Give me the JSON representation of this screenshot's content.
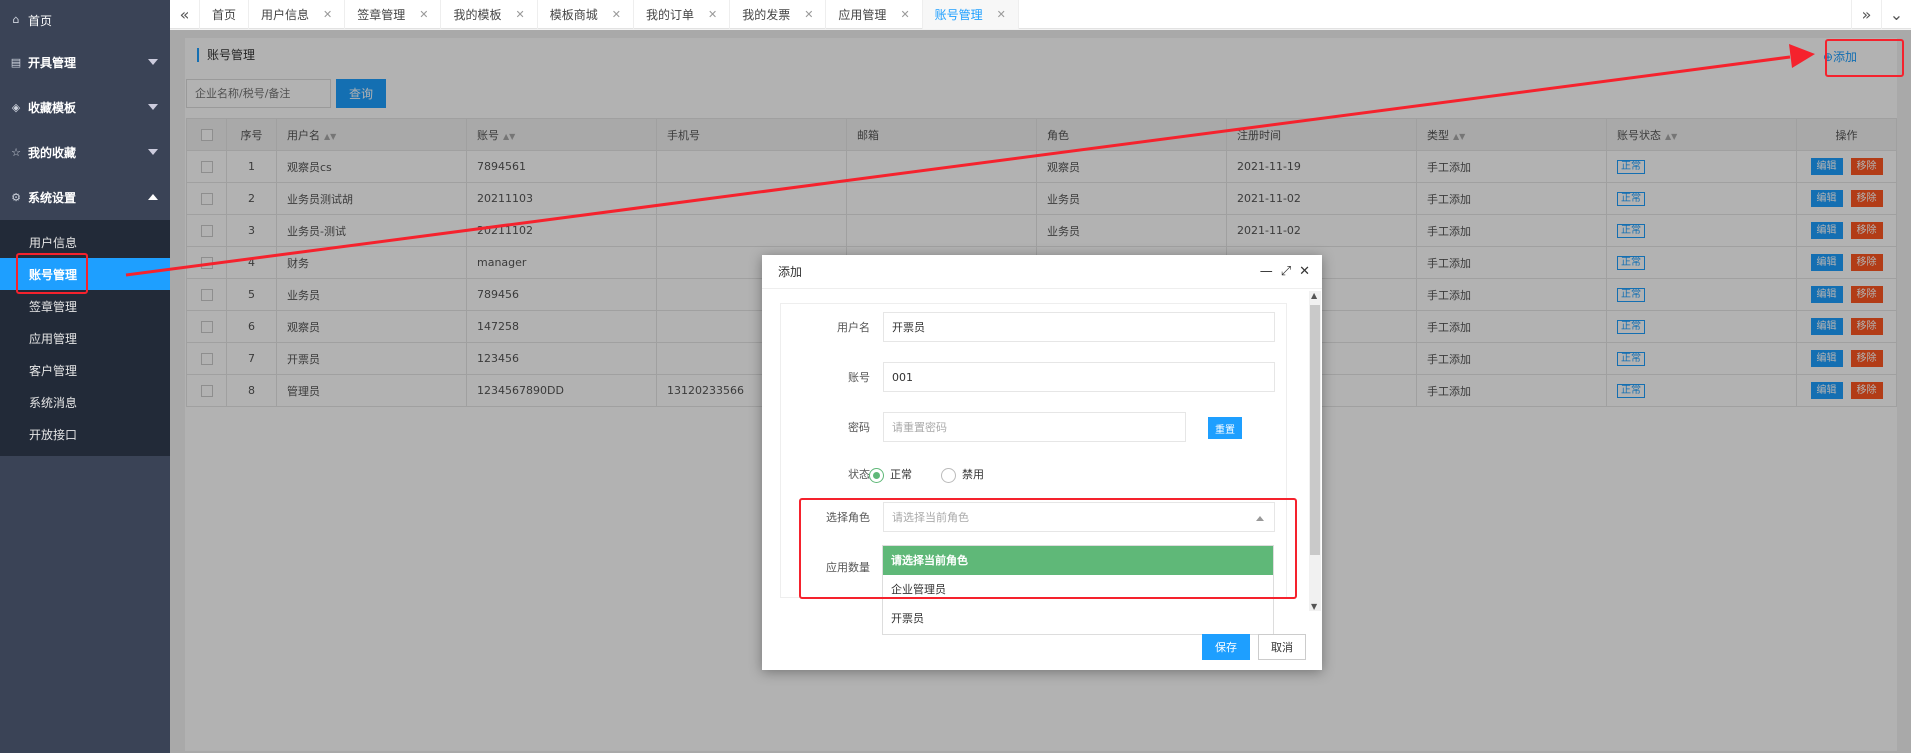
{
  "sidebar": {
    "home": "首页",
    "groups": [
      {
        "label": "开具管理"
      },
      {
        "label": "收藏模板"
      },
      {
        "label": "我的收藏"
      },
      {
        "label": "系统设置"
      }
    ],
    "submenu": [
      "用户信息",
      "账号管理",
      "签章管理",
      "应用管理",
      "客户管理",
      "系统消息",
      "开放接口"
    ]
  },
  "tabs": [
    "首页",
    "用户信息",
    "签章管理",
    "我的模板",
    "模板商城",
    "我的订单",
    "我的发票",
    "应用管理",
    "账号管理"
  ],
  "breadcrumb": "账号管理",
  "add_label": "⊕添加",
  "search": {
    "placeholder": "企业名称/税号/备注",
    "button": "查询"
  },
  "table": {
    "headers": [
      "序号",
      "用户名",
      "账号",
      "手机号",
      "邮箱",
      "角色",
      "注册时间",
      "类型",
      "账号状态",
      "操作"
    ],
    "rows": [
      {
        "no": "1",
        "user": "观察员cs",
        "account": "7894561",
        "phone": "",
        "email": "",
        "role": "观察员",
        "time": "2021-11-19",
        "type": "手工添加"
      },
      {
        "no": "2",
        "user": "业务员测试胡",
        "account": "20211103",
        "phone": "",
        "email": "",
        "role": "业务员",
        "time": "2021-11-02",
        "type": "手工添加"
      },
      {
        "no": "3",
        "user": "业务员-测试",
        "account": "20211102",
        "phone": "",
        "email": "",
        "role": "业务员",
        "time": "2021-11-02",
        "type": "手工添加"
      },
      {
        "no": "4",
        "user": "财务",
        "account": "manager",
        "phone": "",
        "email": "",
        "role": "",
        "time": "",
        "type": "手工添加"
      },
      {
        "no": "5",
        "user": "业务员",
        "account": "789456",
        "phone": "",
        "email": "",
        "role": "",
        "time": "",
        "type": "手工添加"
      },
      {
        "no": "6",
        "user": "观察员",
        "account": "147258",
        "phone": "",
        "email": "",
        "role": "",
        "time": "",
        "type": "手工添加"
      },
      {
        "no": "7",
        "user": "开票员",
        "account": "123456",
        "phone": "",
        "email": "",
        "role": "",
        "time": "",
        "type": "手工添加"
      },
      {
        "no": "8",
        "user": "管理员",
        "account": "1234567890DD",
        "phone": "13120233566",
        "email": "",
        "role": "",
        "time": "",
        "type": "手工添加"
      }
    ],
    "status_label": "正常",
    "edit_label": "编辑",
    "delete_label": "移除"
  },
  "modal": {
    "title": "添加",
    "username_label": "用户名",
    "username_value": "开票员",
    "account_label": "账号",
    "account_value": "001",
    "password_label": "密码",
    "password_placeholder": "请重置密码",
    "reset_label": "重置",
    "status_label": "状态",
    "status_on": "正常",
    "status_off": "禁用",
    "role_label": "选择角色",
    "role_placeholder": "请选择当前角色",
    "app_count_label": "应用数量",
    "role_options": [
      "请选择当前角色",
      "企业管理员",
      "开票员"
    ],
    "save": "保存",
    "cancel": "取消"
  },
  "colors": {
    "primary": "#1e9fff",
    "danger": "#ff5722",
    "success": "#5fb878",
    "sidebar": "#3a4356",
    "annotation": "#f5222d"
  }
}
